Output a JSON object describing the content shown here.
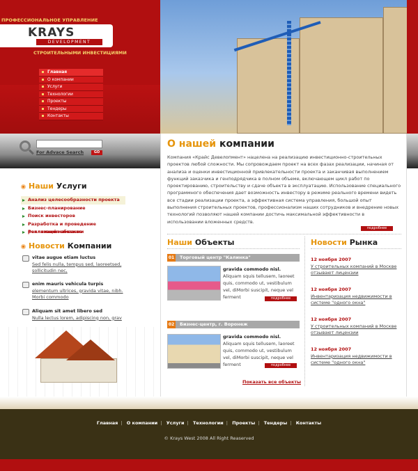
{
  "brand": {
    "tagline_top": "ПРОФЕССИОНАЛЬНОЕ УПРАВЛЕНИЕ",
    "logo": "KRAYS",
    "logo_sub": "DEVELOPMENT",
    "tagline_bottom": "СТРОИТЕЛЬНЫМИ ИНВЕСТИЦИЯМИ"
  },
  "nav": [
    "Главная",
    "О компании",
    "Услуги",
    "Технологии",
    "Проекты",
    "Тендеры",
    "Контакты"
  ],
  "search": {
    "placeholder": "",
    "advance_link": "For Advace Search",
    "go_label": "GO"
  },
  "about": {
    "title_hl": "О нашей",
    "title_rest": "компании",
    "text": "Компания «Крайс Девелопмент» нацелена на реализацию инвестиционно-строительных проектов любой сложности. Мы сопровождаем проект на всех фазах реализации, начиная от анализа и оценки инвестиционной привлекательности проекта и заканчивая выполнением функций заказчика и генподрядчика в полном объеме, включающем цикл работ по проектированию, строительству и сдаче объекта в эксплуатацию. Использование специального программного обеспечения дает возможность инвестору в режиме реального времени видеть все стадии реализации проекта, а эффективная система управления, большой опыт выполнения строительных проектов, профессионализм наших сотрудников и внедрение новых технологий позволяют нашей компании достичь максимальной эффективности в использовании вложенных средств.",
    "more": "подробнее"
  },
  "services": {
    "title_hl": "Наши",
    "title_rest": "Услуги",
    "items": [
      "Анализ целесообразности проекта",
      "Бизнес-планирование",
      "Поиск инвесторов",
      "Разработка и проведение рекламной кампании",
      "Реализация объекта"
    ]
  },
  "news": {
    "title_hl": "Новости",
    "title_rest": "Компании",
    "items": [
      {
        "head": "vitae augue etiam luctus",
        "body1": "Sed felis nulla, tempus sed, laoreetsed,",
        "body2": "sollicitudin nec,"
      },
      {
        "head": "enim mauris vehicula turpis",
        "body1": "elementum ultrices, gravida vitae, nibh.",
        "body2": "Morbi commodo"
      },
      {
        "head": "Aliquam sit amet libero sed",
        "body1": "Nulla lectus lorem, adipiscing non, grav",
        "body2": ""
      }
    ]
  },
  "objects": {
    "title_hl": "Наши",
    "title_rest": "Объекты",
    "items": [
      {
        "num": "01",
        "label": "Торговый центр \"Калинка\"",
        "bold": "gravida commodo nisl.",
        "text": "Aliquam squis tellusem, laoreet quis, commodo ut, vestibulum vel, diMorbi suscipit, neque vel ferment",
        "more": "подробнее"
      },
      {
        "num": "02",
        "label": "Бизнес-центр, г. Воронеж",
        "bold": "gravida commodo nisl.",
        "text": "Aliquam squis tellusem, laoreet quis, commodo ut, vestibulum vel, diMorbi suscipit, neque vel ferment",
        "more": "подробнее"
      }
    ],
    "show_all": "Показать все объекты"
  },
  "market": {
    "title_hl": "Новости",
    "title_rest": "Рынка",
    "items": [
      {
        "date": "12 ноября 2007",
        "text": "У строительных компаний в Москве отзывают лицензии"
      },
      {
        "date": "12 ноября 2007",
        "text": "Инвентаризация недвижимости в системе \"одного окна\""
      },
      {
        "date": "12 ноября 2007",
        "text": "У строительных компаний в Москве отзывают лицензии"
      },
      {
        "date": "12 ноября 2007",
        "text": "Инвентаризация недвижимости в системе \"одного окна\""
      }
    ]
  },
  "footer": {
    "links": [
      "Главная",
      "О компании",
      "Услуги",
      "Технологии",
      "Проекты",
      "Тендеры",
      "Контакты"
    ],
    "copyright": "© Krays West  2008 All Right Reaserved"
  }
}
